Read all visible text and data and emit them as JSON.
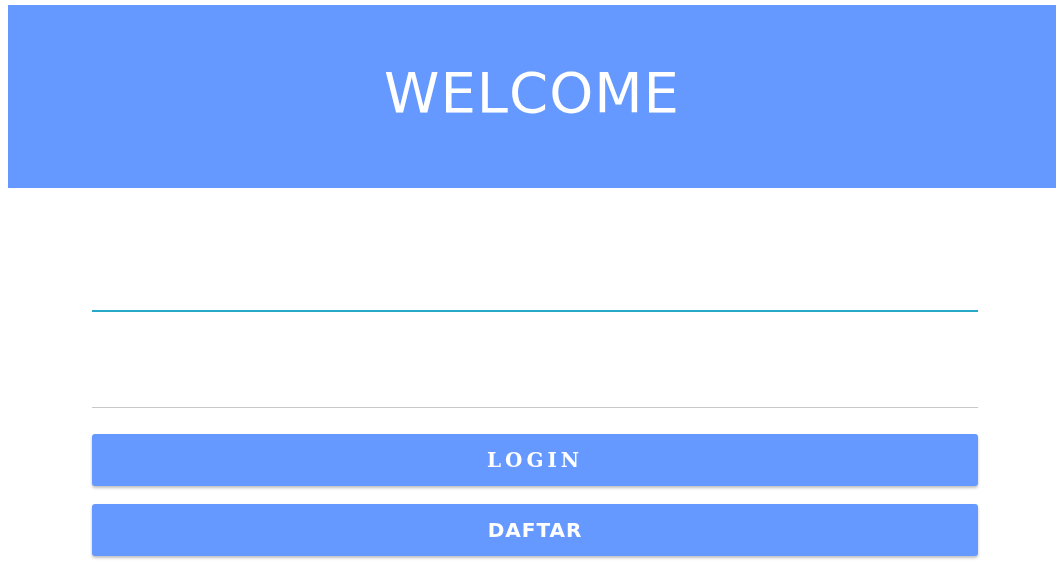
{
  "header": {
    "title": "WELCOME"
  },
  "fields": [
    {
      "focused": true
    },
    {
      "focused": false
    }
  ],
  "buttons": [
    {
      "label": "LOGIN",
      "kind": "spaced"
    },
    {
      "label": "DAFTAR",
      "kind": "plain"
    }
  ]
}
